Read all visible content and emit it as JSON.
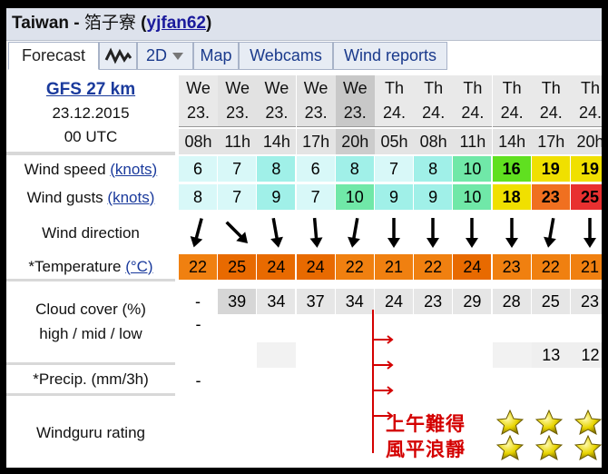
{
  "header": {
    "location": "Taiwan",
    "separator": " - ",
    "spot": "箔子寮",
    "user": "yjfan62",
    "open_paren": " (",
    "close_paren": ")"
  },
  "tabs": [
    "Forecast",
    "2D",
    "Map",
    "Webcams",
    "Wind reports"
  ],
  "model": {
    "name": "GFS 27 km",
    "date": "23.12.2015",
    "time": "00 UTC"
  },
  "labels": {
    "wind_speed": "Wind speed",
    "wind_speed_unit": "(knots)",
    "wind_gusts": "Wind gusts",
    "wind_gusts_unit": "(knots)",
    "wind_direction": "Wind direction",
    "temperature": "*Temperature",
    "temperature_unit": "(°C)",
    "cloud_cover_1": "Cloud cover (%)",
    "cloud_cover_2": "high / mid / low",
    "precip": "*Precip. (mm/3h)",
    "rating": "Windguru rating"
  },
  "columns": [
    {
      "day": "We",
      "date": "23.",
      "hour": "08h",
      "speed": "6",
      "gust": "8",
      "dir": 195,
      "temp": "22",
      "cloud_high": "-",
      "cloud_low": ""
    },
    {
      "day": "We",
      "date": "23.",
      "hour": "11h",
      "speed": "7",
      "gust": "7",
      "dir": 135,
      "temp": "25",
      "cloud_high": "39",
      "cloud_low": ""
    },
    {
      "day": "We",
      "date": "23.",
      "hour": "14h",
      "speed": "8",
      "gust": "9",
      "dir": 170,
      "temp": "24",
      "cloud_high": "34",
      "cloud_low": ""
    },
    {
      "day": "We",
      "date": "23.",
      "hour": "17h",
      "speed": "6",
      "gust": "7",
      "dir": 175,
      "temp": "24",
      "cloud_high": "37",
      "cloud_low": ""
    },
    {
      "day": "We",
      "date": "23.",
      "hour": "20h",
      "speed": "8",
      "gust": "10",
      "dir": 190,
      "temp": "22",
      "cloud_high": "34",
      "cloud_low": ""
    },
    {
      "day": "Th",
      "date": "24.",
      "hour": "05h",
      "speed": "7",
      "gust": "9",
      "dir": 180,
      "temp": "21",
      "cloud_high": "24",
      "cloud_low": ""
    },
    {
      "day": "Th",
      "date": "24.",
      "hour": "08h",
      "speed": "8",
      "gust": "9",
      "dir": 180,
      "temp": "22",
      "cloud_high": "23",
      "cloud_low": ""
    },
    {
      "day": "Th",
      "date": "24.",
      "hour": "11h",
      "speed": "10",
      "gust": "10",
      "dir": 180,
      "temp": "24",
      "cloud_high": "29",
      "cloud_low": ""
    },
    {
      "day": "Th",
      "date": "24.",
      "hour": "14h",
      "speed": "16",
      "gust": "18",
      "dir": 180,
      "temp": "23",
      "cloud_high": "28",
      "cloud_low": ""
    },
    {
      "day": "Th",
      "date": "24.",
      "hour": "17h",
      "speed": "19",
      "gust": "23",
      "dir": 190,
      "temp": "22",
      "cloud_high": "25",
      "cloud_low": "13"
    },
    {
      "day": "Th",
      "date": "24.",
      "hour": "20h",
      "speed": "19",
      "gust": "25",
      "dir": 180,
      "temp": "21",
      "cloud_high": "23",
      "cloud_low": "12"
    }
  ],
  "cloud_mid_first": "-",
  "precip_first": "-",
  "annotation": {
    "line1": "上午難得",
    "line2": "風平浪靜"
  },
  "colors": {
    "orange": "#f08010",
    "orange_dark": "#e86a00"
  }
}
